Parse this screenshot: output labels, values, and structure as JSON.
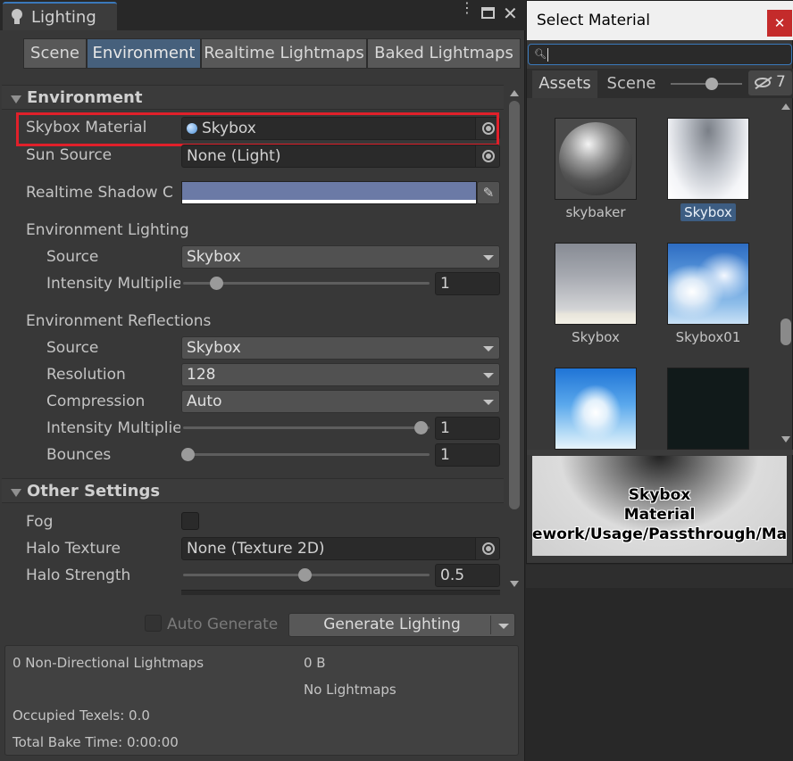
{
  "lighting": {
    "title": "Lighting",
    "tabs": [
      "Scene",
      "Environment",
      "Realtime Lightmaps",
      "Baked Lightmaps"
    ],
    "environment_header": "Environment",
    "skybox_material_label": "Skybox Material",
    "skybox_material_value": "Skybox",
    "sun_source_label": "Sun Source",
    "sun_source_value": "None (Light)",
    "realtime_shadow_label": "Realtime Shadow C",
    "realtime_shadow_color": "#6b7aa6",
    "env_lighting_label": "Environment Lighting",
    "lighting_source_label": "Source",
    "lighting_source_value": "Skybox",
    "lighting_intensity_label": "Intensity Multiplie",
    "lighting_intensity_value": "1",
    "env_reflections_label": "Environment Reflections",
    "refl_source_label": "Source",
    "refl_source_value": "Skybox",
    "resolution_label": "Resolution",
    "resolution_value": "128",
    "compression_label": "Compression",
    "compression_value": "Auto",
    "refl_intensity_label": "Intensity Multiplie",
    "refl_intensity_value": "1",
    "bounces_label": "Bounces",
    "bounces_value": "1",
    "other_header": "Other Settings",
    "fog_label": "Fog",
    "halo_texture_label": "Halo Texture",
    "halo_texture_value": "None (Texture 2D)",
    "halo_strength_label": "Halo Strength",
    "halo_strength_value": "0.5",
    "auto_generate_label": "Auto Generate",
    "generate_button": "Generate Lighting",
    "stats": {
      "lightmaps": "0 Non-Directional Lightmaps",
      "size": "0 B",
      "none": "No Lightmaps",
      "texels": "Occupied Texels: 0.0",
      "bake_time": "Total Bake Time: 0:00:00"
    }
  },
  "picker": {
    "title": "Select Material",
    "search_value": "",
    "tabs": [
      "Assets",
      "Scene"
    ],
    "hidden_count": "7",
    "items": [
      {
        "name": "skybaker",
        "selected": false
      },
      {
        "name": "Skybox",
        "selected": true
      },
      {
        "name": "Skybox",
        "selected": false
      },
      {
        "name": "Skybox01",
        "selected": false
      },
      {
        "name": "",
        "selected": false
      },
      {
        "name": "",
        "selected": false
      }
    ],
    "preview_line1": "Skybox",
    "preview_line2": "Material",
    "preview_line3": "ework/Usage/Passthrough/Ma"
  },
  "colors": {
    "accent": "#3d5d82",
    "highlight_box": "#e0202a",
    "close_button": "#c42b2b"
  }
}
